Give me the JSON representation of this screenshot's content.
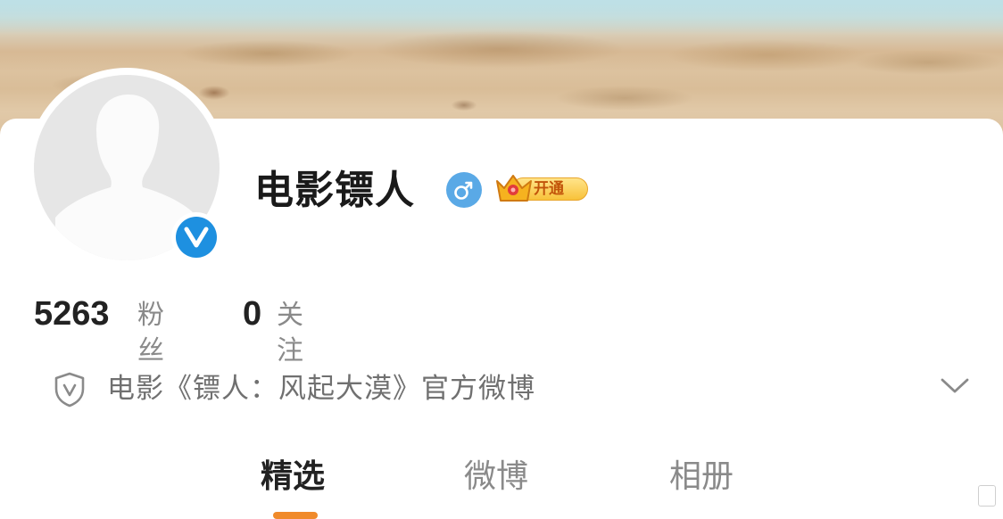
{
  "profile": {
    "name": "电影镖人",
    "vip_label": "开通",
    "gender_icon": "male-icon",
    "verified_icon": "verified-v-icon",
    "fans_count": "5263",
    "fans_label": "粉丝",
    "following_count": "0",
    "following_label": "关注",
    "bio": "电影《镖人：风起大漠》官方微博"
  },
  "tabs": [
    {
      "label": "精选",
      "active": true
    },
    {
      "label": "微博",
      "active": false
    },
    {
      "label": "相册",
      "active": false
    }
  ],
  "colors": {
    "verify_blue": "#1e90e0",
    "gender_blue": "#5aa9e6",
    "tab_accent": "#f08a2a",
    "vip_gold": "#f8c23a"
  }
}
